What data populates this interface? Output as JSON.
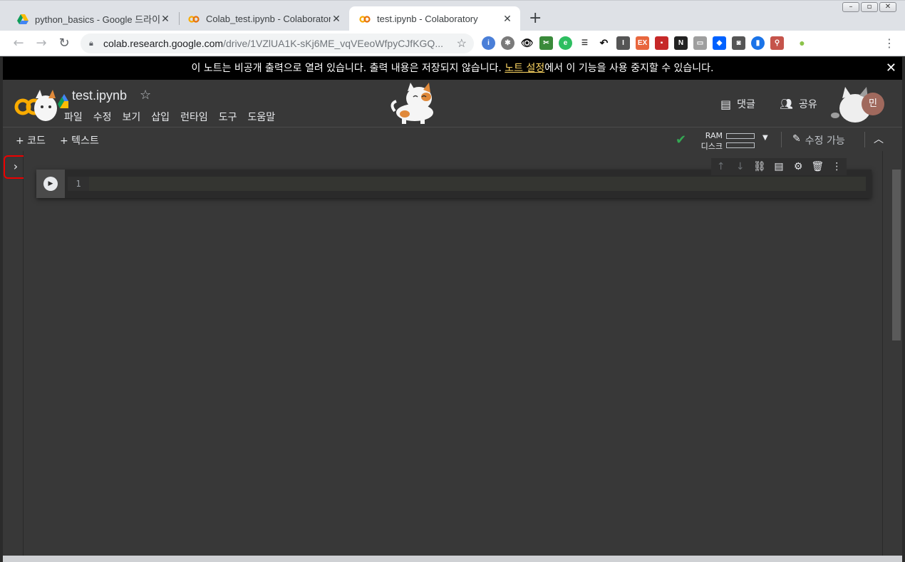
{
  "browser": {
    "tabs": [
      {
        "title": "python_basics - Google 드라이브",
        "icon": "google-drive-icon",
        "active": false
      },
      {
        "title": "Colab_test.ipynb - Colaboratory",
        "icon": "colab-icon",
        "active": false
      },
      {
        "title": "test.ipynb - Colaboratory",
        "icon": "colab-icon",
        "active": true
      }
    ],
    "new_tab": "+",
    "url_host": "colab.research.google.com",
    "url_path": "/drive/1VZlUA1K-sKj6ME_vqVEeoWfpyCJfKGQ...",
    "extension_labels": [
      "EX"
    ]
  },
  "notice": {
    "text_before": "이 노트는 비공개 출력으로 열려 있습니다. 출력 내용은 저장되지 않습니다. ",
    "link_text": "노트 설정",
    "text_after": "에서 이 기능을 사용 중지할 수 있습니다."
  },
  "header": {
    "doc_title": "test.ipynb",
    "menu": [
      "파일",
      "수정",
      "보기",
      "삽입",
      "런타임",
      "도구",
      "도움말"
    ],
    "comment_label": "댓글",
    "share_label": "공유",
    "avatar_initial": "민"
  },
  "toolbar": {
    "add_code": "+ 코드",
    "add_text": "+ 텍스트",
    "ram_label": "RAM",
    "disk_label": "디스크",
    "edit_mode": "수정 가능"
  },
  "cell": {
    "line_number": "1",
    "code": ""
  },
  "colors": {
    "accent_yellow": "#f9ab00",
    "check_green": "#34a853",
    "highlight_red": "#e00000"
  }
}
